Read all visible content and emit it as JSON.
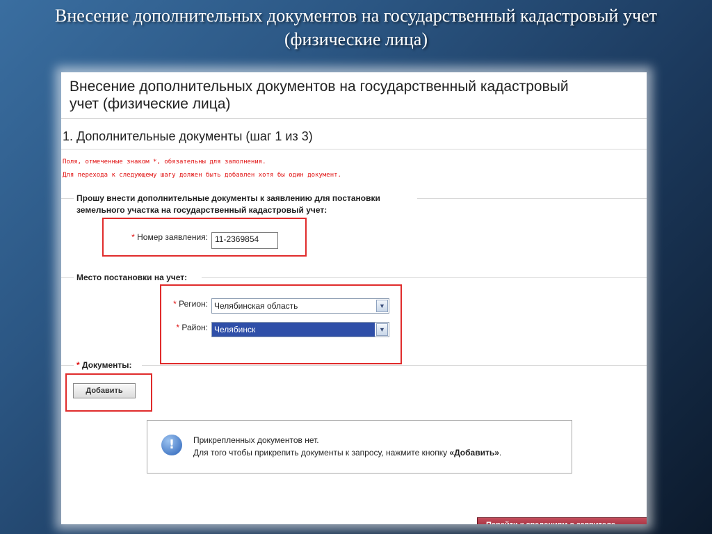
{
  "slide": {
    "title_line1": "Внесение дополнительных документов на государственный кадастровый учет",
    "title_line2": "(физические лица)"
  },
  "form": {
    "page_title_line1": "Внесение дополнительных документов на государственный кадастровый",
    "page_title_line2": "учет (физические лица)",
    "step_title": "1. Дополнительные документы (шаг 1 из 3)",
    "note_required": "Поля, отмеченные знаком *, обязательны для заполнения.",
    "note_next_step": "Для перехода к следующему шагу должен быть добавлен хотя бы один документ.",
    "request_section_line1": "Прошу внести дополнительные документы к заявлению для постановки",
    "request_section_line2": "земельного участка на государственный кадастровый учет:",
    "required_mark": "*",
    "application_number_label": "Номер заявления:",
    "application_number_value": "11-2369854",
    "location_section": "Место постановки на учет:",
    "region_label": "Регион:",
    "region_value": "Челябинская область",
    "district_label": "Район:",
    "district_value": "Челябинск",
    "documents_label": "Документы:",
    "add_button": "Добавить",
    "info_line1": "Прикрепленных документов нет.",
    "info_line2_prefix": "Для того чтобы прикрепить документы к запросу, нажмите кнопку ",
    "info_line2_bold": "«Добавить»",
    "info_line2_suffix": ".",
    "next_button": "Перейти к сведениям о заявителе"
  },
  "colors": {
    "highlight_box": "#e02b2b",
    "required_mark": "#e01010",
    "selected_option_bg": "#2f4fa8",
    "next_button": "#a32a3a"
  },
  "icons": {
    "info": "info-circle-icon",
    "dropdown": "chevron-down-icon"
  }
}
